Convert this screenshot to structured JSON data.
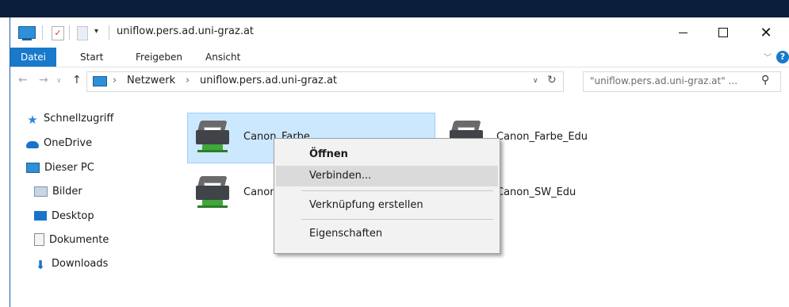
{
  "window": {
    "title": "uniflow.pers.ad.uni-graz.at",
    "quick_access_arrow": "▾"
  },
  "ribbon": {
    "tabs": [
      "Datei",
      "Start",
      "Freigeben",
      "Ansicht"
    ],
    "help": "?"
  },
  "address": {
    "crumbs": [
      "Netzwerk",
      "uniflow.pers.ad.uni-graz.at"
    ],
    "search_placeholder": "\"uniflow.pers.ad.uni-graz.at\" ..."
  },
  "nav_pane": {
    "items": [
      {
        "label": "Schnellzugriff",
        "icon": "star-icon"
      },
      {
        "label": "OneDrive",
        "icon": "cloud-icon"
      },
      {
        "label": "Dieser PC",
        "icon": "computer-icon"
      },
      {
        "label": "Bilder",
        "icon": "pictures-folder-icon"
      },
      {
        "label": "Desktop",
        "icon": "desktop-folder-icon"
      },
      {
        "label": "Dokumente",
        "icon": "documents-folder-icon"
      },
      {
        "label": "Downloads",
        "icon": "downloads-folder-icon"
      }
    ]
  },
  "content": {
    "printers": [
      {
        "label": "Canon_Farbe",
        "icon": "network-printer-icon"
      },
      {
        "label": "Canon_Farbe_Edu",
        "icon": "network-printer-icon"
      },
      {
        "label": "Canon_SW",
        "icon": "network-printer-icon"
      },
      {
        "label": "Canon_SW_Edu",
        "icon": "network-printer-icon"
      }
    ]
  },
  "context_menu": {
    "items": [
      "Öffnen",
      "Verbinden...",
      "Verknüpfung erstellen",
      "Eigenschaften"
    ]
  },
  "colors": {
    "accent": "#1979ca",
    "selection": "#cce8ff",
    "menu_bg": "#f2f2f2"
  }
}
